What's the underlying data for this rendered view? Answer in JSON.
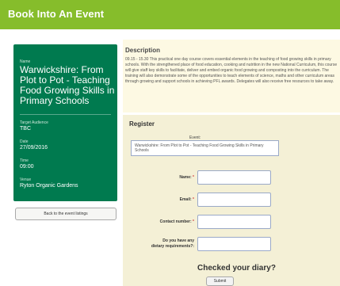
{
  "header": {
    "title": "Book Into An Event"
  },
  "sidebar": {
    "name_label": "Name",
    "event_name": "Warwickshire: From Plot to Pot - Teaching Food Growing Skills in Primary Schools",
    "audience_label": "Target Audience",
    "audience_value": "TBC",
    "date_label": "Date",
    "date_value": "27/09/2016",
    "time_label": "Time",
    "time_value": "09:00",
    "venue_label": "Venue",
    "venue_value": "Ryton Organic Gardens",
    "back_label": "Back to the event listings"
  },
  "description": {
    "heading": "Description",
    "text": "09.15 - 15.30 This practical one day course covers essential elements in the teaching of food growing skills in primary schools. With the strengthened place of food education, cooking and nutrition in the new National Curriculum, this course will give staff key skills to facilitate, deliver and embed organic food growing and composting into the curriculum. The training will also demonstrate some of the opportunities to teach elements of science, maths and other curriculum areas through growing and support schools in achieving PFL awards. Delegates will also receive free resources to take away."
  },
  "register": {
    "heading": "Register",
    "event_label": "Event:",
    "event_value": "Warwickshire: From Plot to Pot - Teaching Food Growing Skills in Primary Schools",
    "name_label": "Name:",
    "email_label": "Email:",
    "contact_label": "Contact number:",
    "dietary_label_1": "Do you have any",
    "dietary_label_2": "dietary requirements?:",
    "required_mark": "*",
    "checked_diary": "Checked your diary?",
    "submit_label": "Submit"
  },
  "colors": {
    "header_green": "#86bd2b",
    "sidebar_green": "#007a4f",
    "description_bg": "#fdf9e3",
    "register_bg": "#f4f0d6",
    "required_red": "#d23c3c"
  }
}
